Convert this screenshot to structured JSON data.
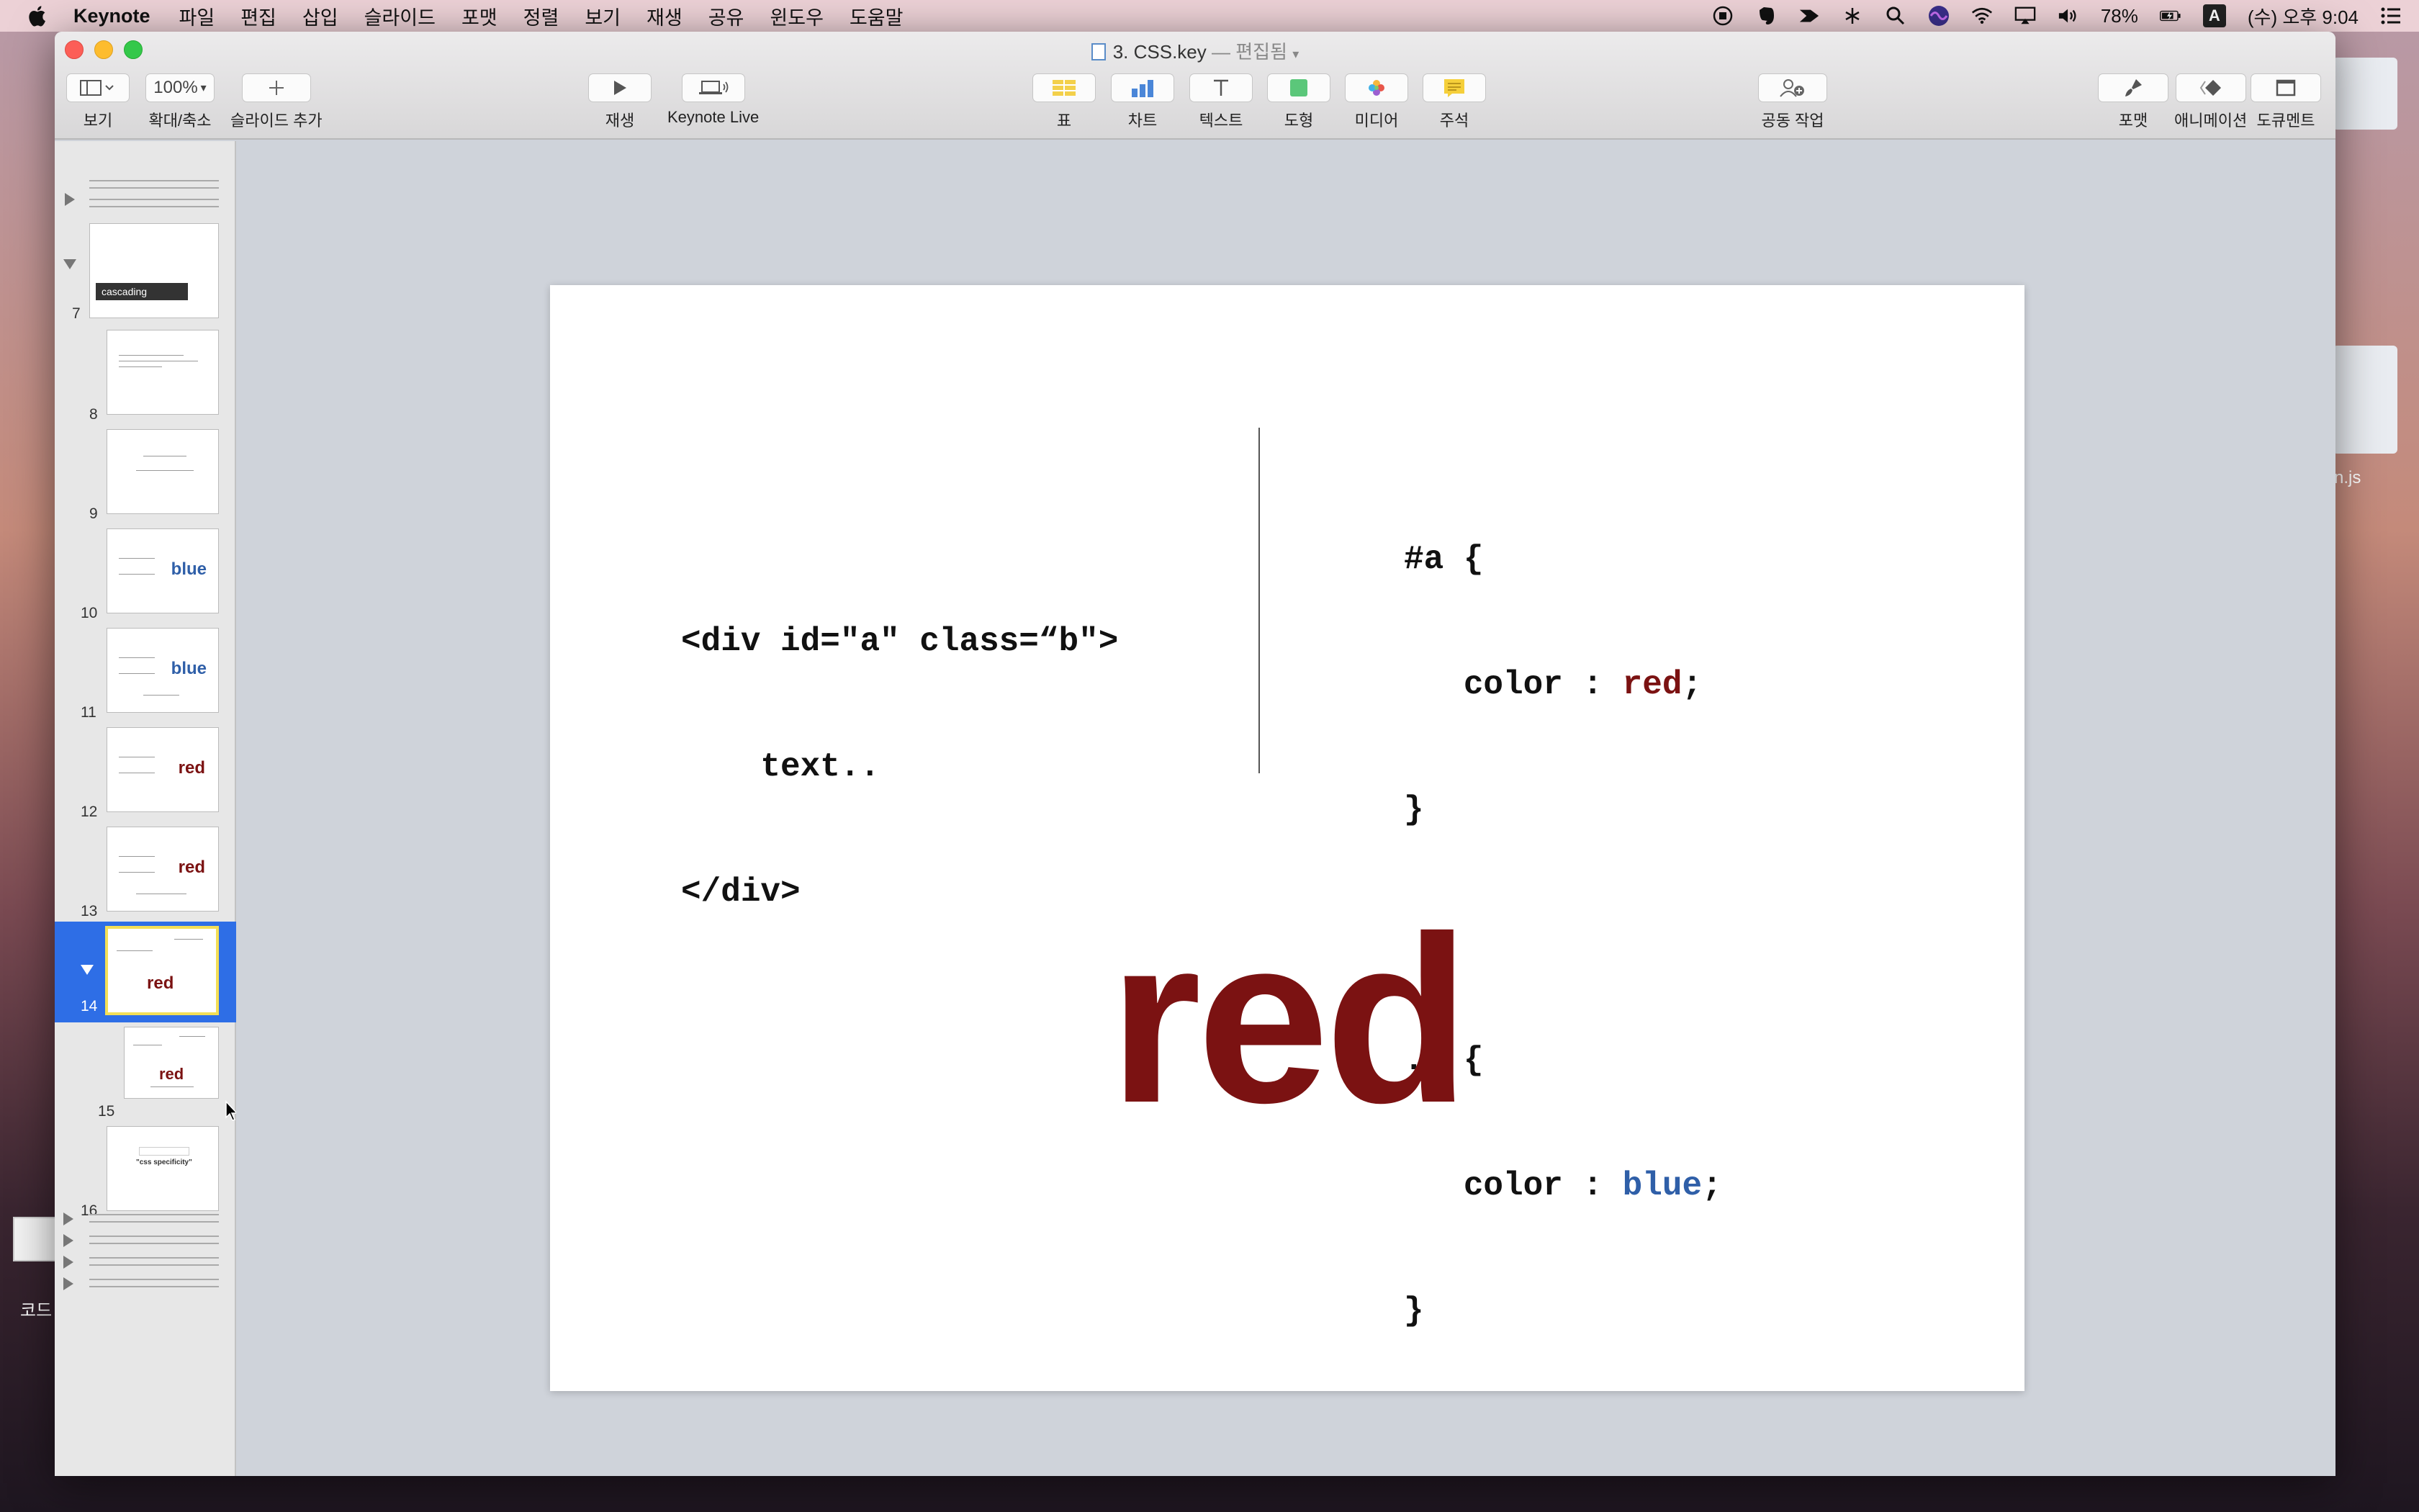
{
  "menubar": {
    "app_name": "Keynote",
    "items": [
      "파일",
      "편집",
      "삽입",
      "슬라이드",
      "포맷",
      "정렬",
      "보기",
      "재생",
      "공유",
      "윈도우",
      "도움말"
    ],
    "battery": "78%",
    "ime": "A",
    "clock": "(수) 오후 9:04"
  },
  "window": {
    "doc_title": "3. CSS.key",
    "doc_status": "— 편집됨"
  },
  "toolbar": {
    "view": "보기",
    "zoom_value": "100%",
    "zoom": "확대/축소",
    "add_slide": "슬라이드 추가",
    "play": "재생",
    "keynote_live": "Keynote Live",
    "table": "표",
    "chart": "차트",
    "text": "텍스트",
    "shape": "도형",
    "media": "미디어",
    "comment": "주석",
    "collaborate": "공동 작업",
    "format": "포맷",
    "animate": "애니메이션",
    "document": "도큐멘트"
  },
  "navigator": {
    "cascading_label": "cascading",
    "slides": [
      {
        "num": "7"
      },
      {
        "num": "8"
      },
      {
        "num": "9"
      },
      {
        "num": "10",
        "word": "blue"
      },
      {
        "num": "11",
        "word": "blue"
      },
      {
        "num": "12",
        "word": "red"
      },
      {
        "num": "13",
        "word": "red"
      },
      {
        "num": "14",
        "word": "red"
      },
      {
        "num": "15",
        "word": "red"
      },
      {
        "num": "16",
        "search_word": "\"css specificity\""
      }
    ]
  },
  "slide": {
    "html_code": {
      "line1": "<div id=\"a\" class=“b\">",
      "line2": "    text..",
      "line3": "</div>"
    },
    "css_code": {
      "a_selector": "#a {",
      "a_prop": "   color : ",
      "a_value": "red",
      "semi": ";",
      "close": "}",
      "b_selector": ".b {",
      "b_prop": "   color : ",
      "b_value": "blue"
    },
    "result": "red"
  },
  "desktop": {
    "right_file_label": "n.js",
    "left_file_label": "코드"
  },
  "colors": {
    "red_text": "#7b1212",
    "blue_text": "#2f5fa8",
    "selection": "#2e6ee6"
  }
}
